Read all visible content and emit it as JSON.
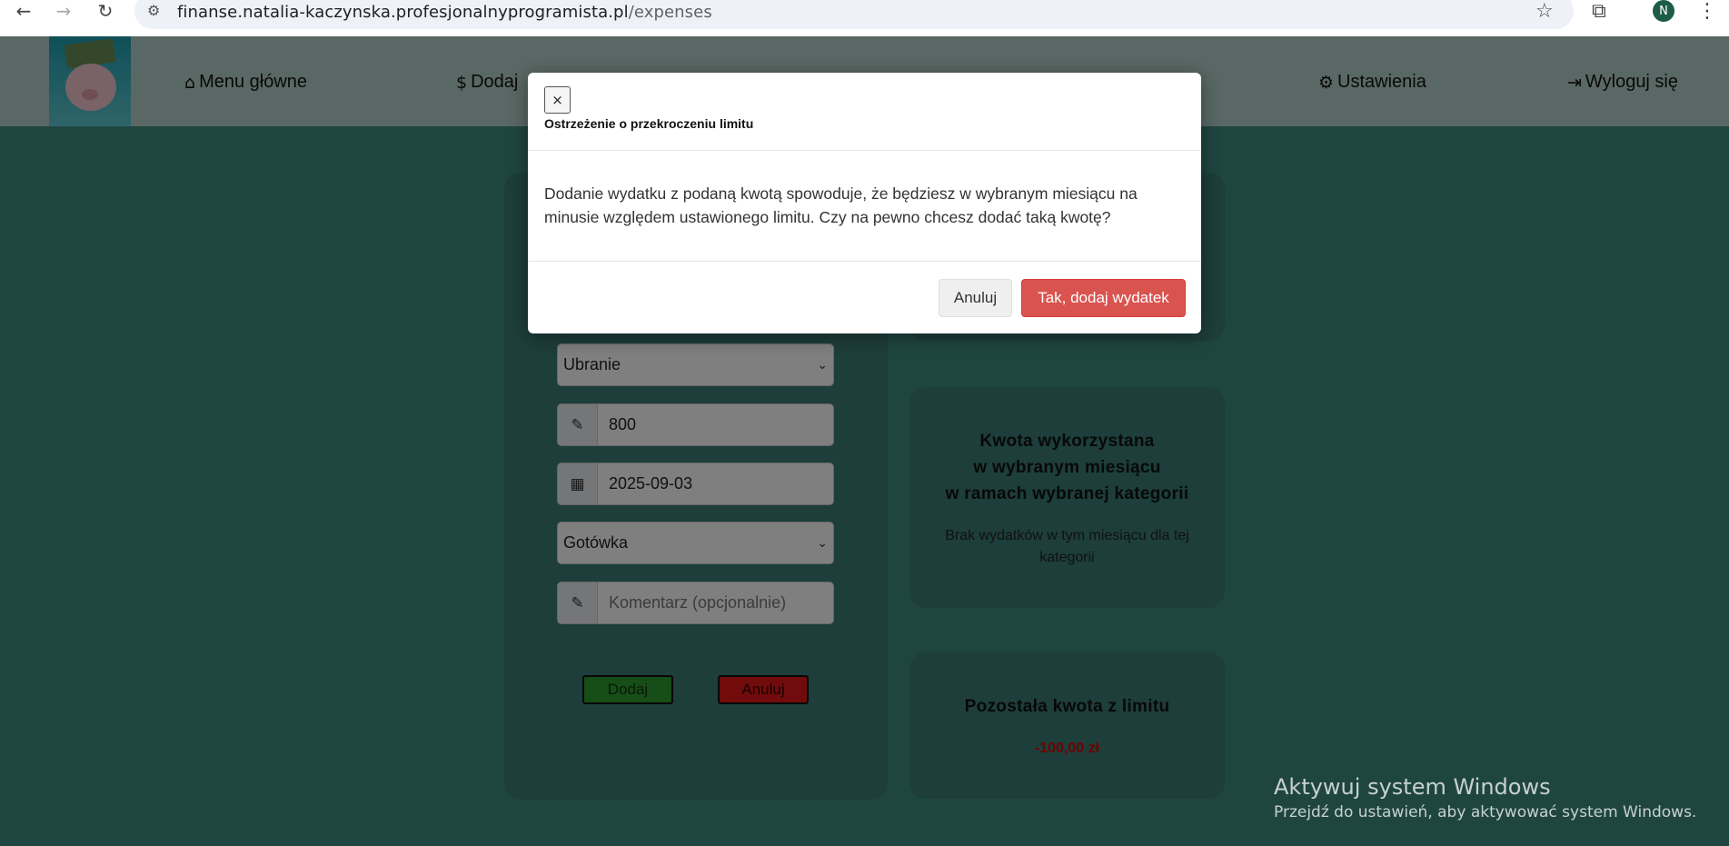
{
  "browser": {
    "url_host": "finanse.natalia-kaczynska.profesjonalnyprogramista.pl",
    "url_path": "/expenses",
    "profile_initial": "N"
  },
  "nav": {
    "items": [
      {
        "label": "Menu główne",
        "icon": "home-icon"
      },
      {
        "label": "Dodaj",
        "icon": "dollar-icon"
      },
      {
        "label": "Ustawienia",
        "icon": "gear-icon"
      },
      {
        "label": "Wyloguj się",
        "icon": "logout-icon"
      }
    ]
  },
  "form": {
    "category": "Ubranie",
    "amount": "800",
    "date": "2025-09-03",
    "payment_method": "Gotówka",
    "comment_placeholder": "Komentarz (opcjonalnie)",
    "add_label": "Dodaj",
    "cancel_label": "Anuluj"
  },
  "cards": {
    "used": {
      "title_line1": "Kwota wykorzystana",
      "title_line2": "w wybranym miesiącu",
      "title_line3": "w ramach wybranej kategorii",
      "text": "Brak wydatków w tym miesiącu dla tej kategorii"
    },
    "remaining": {
      "title": "Pozostała kwota z limitu",
      "value": "-100,00 zł"
    }
  },
  "modal": {
    "close_symbol": "×",
    "title": "Ostrzeżenie o przekroczeniu limitu",
    "body": "Dodanie wydatku z podaną kwotą spowoduje, że będziesz w wybranym miesiącu na minusie względem ustawionego limitu. Czy na pewno chcesz dodać taką kwotę?",
    "cancel_label": "Anuluj",
    "confirm_label": "Tak, dodaj wydatek"
  },
  "watermark": {
    "title": "Aktywuj system Windows",
    "subtitle": "Przejdź do ustawień, aby aktywować system Windows."
  },
  "colors": {
    "page_bg": "#3f8a80",
    "navbar_bg": "#b3d0c8",
    "card_bg": "#3a7d74",
    "confirm_button": "#d9534f",
    "negative_value": "#e00000"
  }
}
